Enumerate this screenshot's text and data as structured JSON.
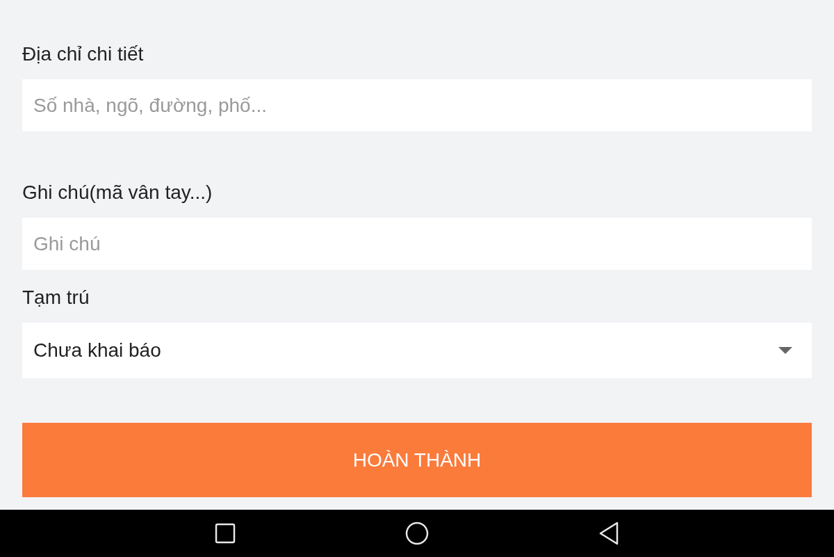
{
  "fields": [
    {
      "kind": "text",
      "label": "Địa chỉ chi tiết",
      "placeholder": "Số nhà, ngõ, đường, phố..."
    },
    {
      "kind": "text",
      "label": "Ghi chú(mã vân tay...)",
      "placeholder": "Ghi chú"
    },
    {
      "kind": "select",
      "label": "Tạm trú",
      "value": "Chưa khai báo"
    }
  ],
  "submit_button": "HOÀN THÀNH"
}
